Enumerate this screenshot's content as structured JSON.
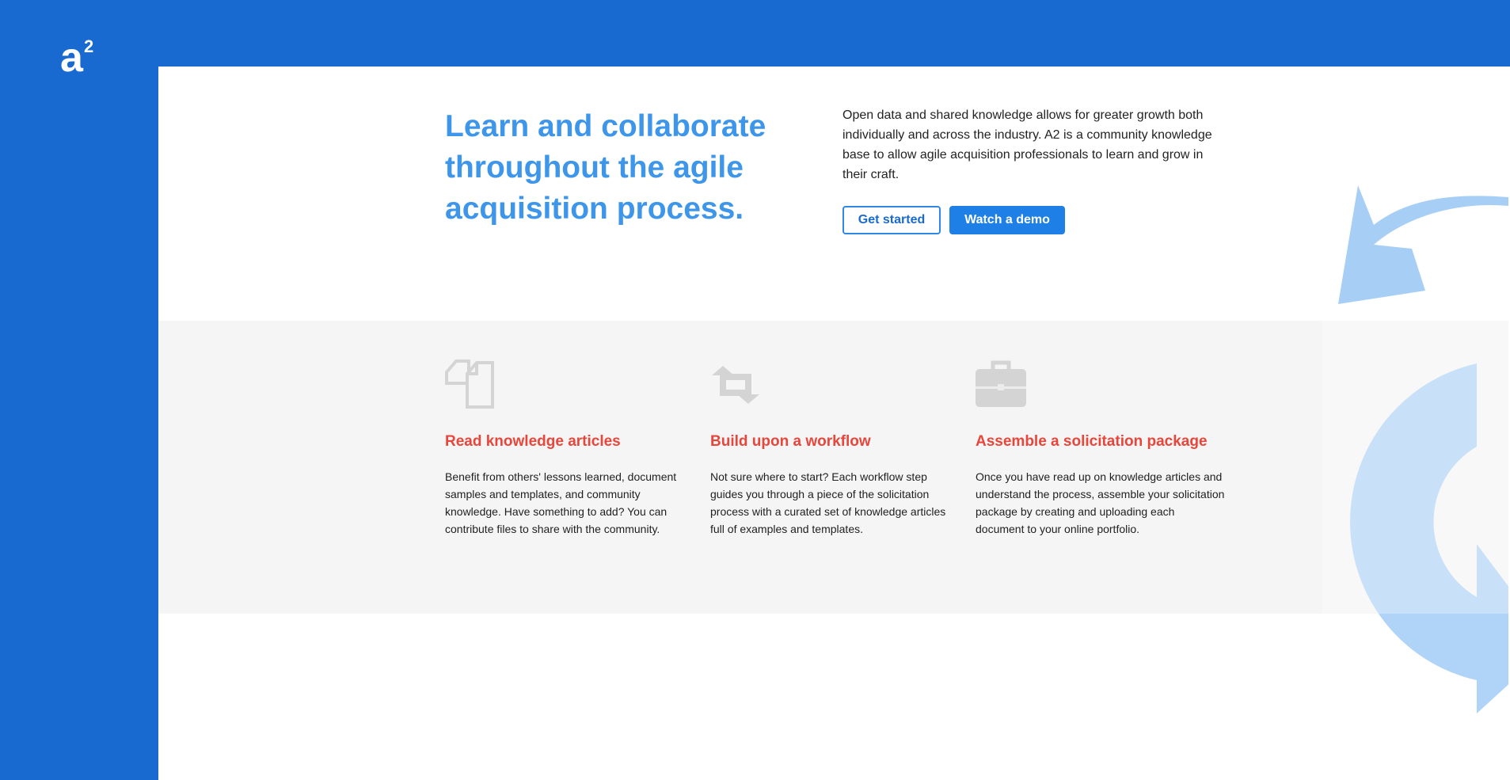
{
  "brand": {
    "logo_letter": "a",
    "logo_superscript": "2"
  },
  "hero": {
    "headline": "Learn and collaborate throughout the agile acquisition process.",
    "intro": "Open data and shared knowledge allows for greater growth both individually and across the industry. A2 is a community knowledge base to allow agile acquisition professionals to learn and grow in their craft.",
    "get_started_label": "Get started",
    "watch_demo_label": "Watch a demo"
  },
  "features": [
    {
      "icon": "documents-icon",
      "title": "Read knowledge articles",
      "body": "Benefit from others' lessons learned, document samples and templates, and community knowledge. Have something to add? You can contribute files to share with the community."
    },
    {
      "icon": "workflow-icon",
      "title": "Build upon a workflow",
      "body": "Not sure where to start? Each workflow step guides you through a piece of the solicitation process with a curated set of knowledge articles full of examples and templates."
    },
    {
      "icon": "briefcase-icon",
      "title": "Assemble a solicitation package",
      "body": "Once you have read up on knowledge articles and understand the process, assemble your solicitation package by creating and uploading each document to your online portfolio."
    }
  ],
  "colors": {
    "brand_blue": "#196ad0",
    "headline_blue": "#3e96ea",
    "feature_title_red": "#e8453b",
    "band_gray": "#f5f5f5",
    "deco_light_blue": "#a7cff6"
  }
}
